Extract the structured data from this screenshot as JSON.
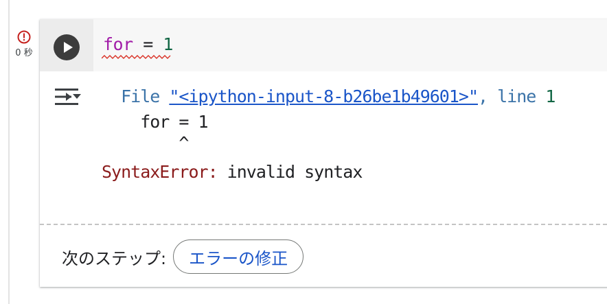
{
  "status": {
    "icon": "error-icon",
    "elapsed": "0 秒",
    "error_color": "#c5221f"
  },
  "cell": {
    "run_icon": "play-icon",
    "code": {
      "keyword": "for",
      "operator": " = ",
      "number": "1"
    },
    "output_toggle_icon": "output-toggle-icon",
    "traceback": {
      "file_prefix": "  File ",
      "file_link": "\"<ipython-input-8-b26be1b49601>\"",
      "line_prefix": ", line ",
      "line_number": "1",
      "code_line": "    for = 1",
      "caret_line": "        ^",
      "error_name": "SyntaxError:",
      "error_message": " invalid syntax"
    },
    "next_steps": {
      "label": "次のステップ:",
      "fix_button": "エラーの修正"
    }
  },
  "colors": {
    "keyword": "#a11ca8",
    "number": "#116644",
    "link": "#1a55c8",
    "error_name": "#8b1c1c"
  }
}
